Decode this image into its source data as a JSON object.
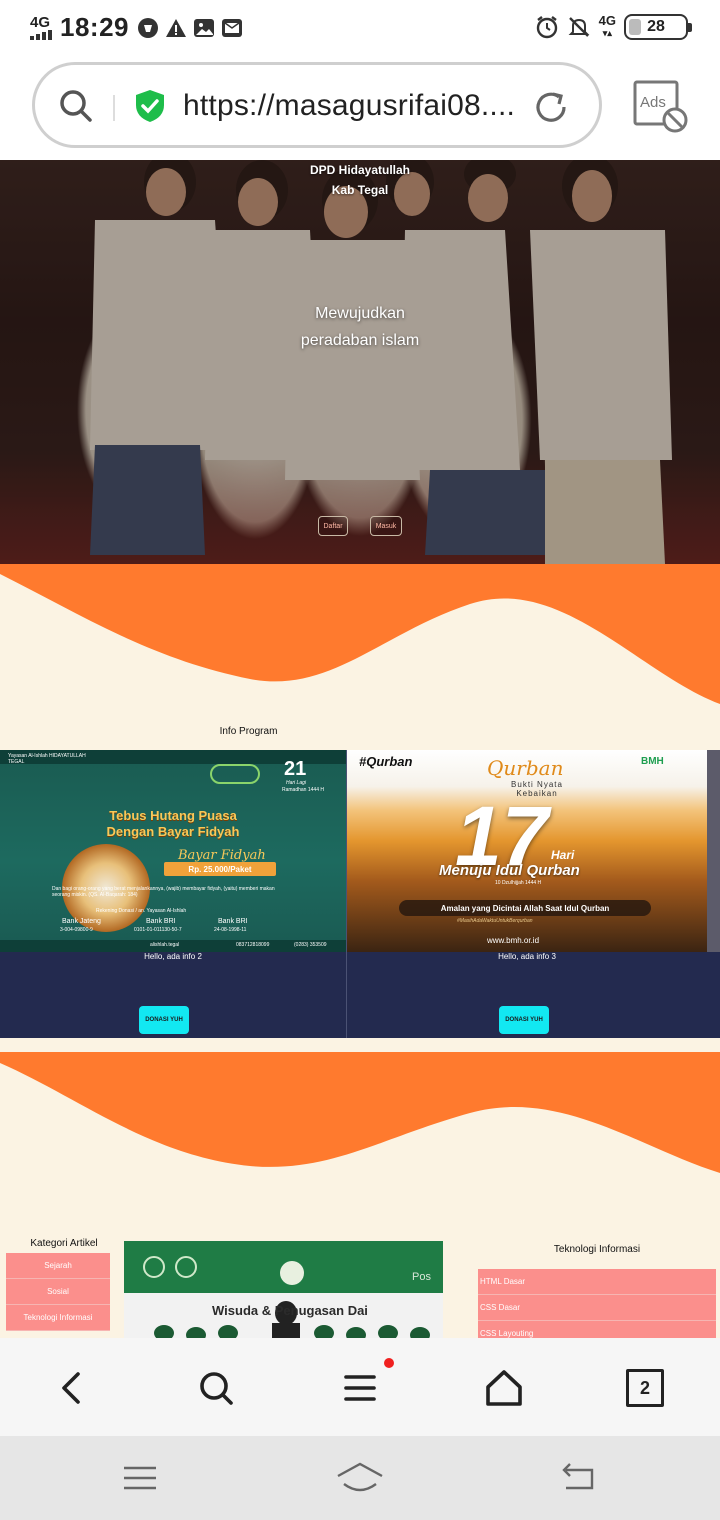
{
  "status_bar": {
    "network": "4G",
    "time": "18:29",
    "right_network": "4G",
    "battery": "28"
  },
  "url_bar": {
    "url": "https://masagusrifai08....",
    "ads_label": "Ads"
  },
  "hero": {
    "org_line1": "DPD Hidayatullah",
    "org_line2": "Kab Tegal",
    "tagline_line1": "Mewujudkan",
    "tagline_line2": "peradaban islam",
    "register_button": "Daftar",
    "login_button": "Masuk"
  },
  "info_program": {
    "label": "Info Program",
    "cards": [
      {
        "caption": "Hello, ada info 2",
        "button": "DONASI YUH",
        "poster": {
          "org": "Yayasan Al-Ishlah HIDAYATULLAH TEGAL",
          "day": "21",
          "day_sub": "Hari Lagi",
          "month": "Ramadhan 1444 H",
          "headline_1": "Tebus Hutang Puasa",
          "headline_2": "Dengan Bayar Fidyah",
          "script": "Bayar Fidyah",
          "price": "Rp. 25.000/Paket",
          "body": "Dan bagi orang-orang yang berat menjalankannya, (wajib) membayar fidyah, (yaitu) memberi makan seorang miskin. (QS. Al-Baqarah: 184)",
          "rekening": "Rekening Donasi / an. Yayasan Al-Ishlah",
          "bank_1": "Bank Jateng",
          "bank_1_no": "3-004-09800-9",
          "bank_2": "Bank BRI",
          "bank_2_no": "0101-01-011130-50-7",
          "bank_3": "Bank BRI",
          "bank_3_no": "24-08-1998-11",
          "footer_social": "alishlah.tegal",
          "footer_phone": "083712818099",
          "footer_phone_2": "(0283) 353509"
        }
      },
      {
        "caption": "Hello, ada info 3",
        "button": "DONASI YUH",
        "poster": {
          "hashtag": "#Qurban",
          "brand": "BMH",
          "title_script": "Qurban",
          "subtitle": "Bukti Nyata Kebaikan",
          "days": "17",
          "hari": "Hari",
          "headline": "Menuju Idul Qurban",
          "date": "10 Dzulhijjah 1444 H",
          "banner": "Amalan yang Dicintai Allah Saat Idul Qurban",
          "hashtag_2": "#MasihAdaWaktuUntukBerqurban",
          "website": "www.bmh.or.id"
        }
      }
    ]
  },
  "kategori": {
    "title": "Kategori Artikel",
    "items": [
      "Sejarah",
      "Sosial",
      "Teknologi Informasi"
    ]
  },
  "featured": {
    "text": "Wisuda & Penugasan Dai",
    "corner": "Pos"
  },
  "teknologi": {
    "title": "Teknologi Informasi",
    "items": [
      "HTML Dasar",
      "CSS Dasar",
      "CSS Layouting"
    ]
  },
  "bottom_nav": {
    "tabs_count": "2"
  },
  "colors": {
    "orange": "#ff7a2e",
    "cream": "#fbf3e3",
    "navy": "#232a4f",
    "cyan": "#12e8f2",
    "pink": "#fb8f8c",
    "green_shield": "#1ebd4a"
  },
  "icons": {
    "status": [
      "signal-icon",
      "alert-icon",
      "warning-icon",
      "gallery-icon",
      "mail-icon",
      "alarm-icon",
      "mute-icon",
      "battery-icon"
    ],
    "toolbar": [
      "search-icon",
      "shield-icon",
      "reload-icon",
      "ads-block-icon"
    ],
    "bottom": [
      "back-icon",
      "search-icon",
      "menu-icon",
      "home-icon",
      "tabs-icon"
    ],
    "system": [
      "recents-icon",
      "home-icon",
      "back-icon"
    ]
  }
}
